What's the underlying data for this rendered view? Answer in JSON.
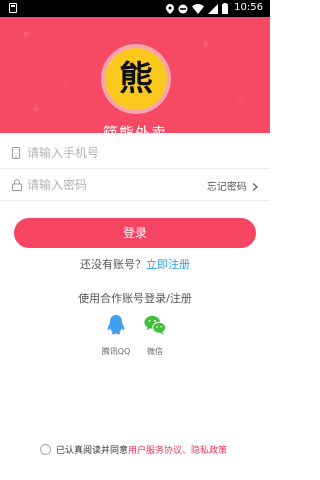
{
  "status": {
    "time": "10:56"
  },
  "header": {
    "logo_char": "熊",
    "app_name": "筷熊外卖"
  },
  "form": {
    "phone_placeholder": "请输入手机号",
    "password_placeholder": "请输入密码",
    "forgot_label": "忘记密码"
  },
  "actions": {
    "login_label": "登录",
    "no_account_text": "还没有账号？",
    "register_link": "立即注册"
  },
  "partner": {
    "title": "使用合作账号登录/注册",
    "qq_label": "腾讯QQ",
    "wechat_label": "微信"
  },
  "agreement": {
    "prefix": "已认真阅读并同意",
    "service_link": "用户服务协议",
    "separator": "、",
    "privacy_link": "隐私政策"
  },
  "colors": {
    "brand": "#f64a64",
    "button": "#f54563",
    "link": "#2aa0ea",
    "logo": "#fbc81e",
    "qq": "#3fa0f0",
    "wechat": "#3fbf3a"
  }
}
